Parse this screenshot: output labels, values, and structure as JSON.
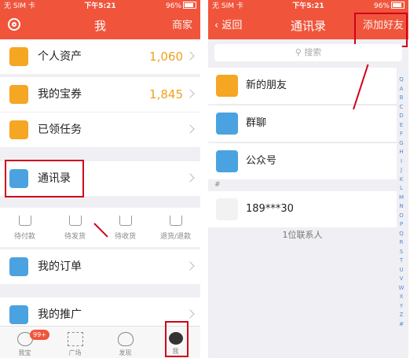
{
  "status": {
    "carrier": "无 SIM 卡",
    "time": "下午5:21",
    "battery": "96%"
  },
  "left": {
    "nav": {
      "title": "我",
      "right": "商家"
    },
    "items": [
      {
        "label": "个人资产",
        "value": "1,060",
        "icon": "wallet-icon",
        "color": "#f5a623"
      },
      {
        "label": "我的宝券",
        "value": "1,845",
        "icon": "coupon-icon",
        "color": "#f5a623"
      },
      {
        "label": "已领任务",
        "value": "",
        "icon": "task-icon",
        "color": "#f5a623"
      },
      {
        "label": "通讯录",
        "value": "",
        "icon": "contacts-icon",
        "color": "#4aa3e0"
      },
      {
        "label": "我的订单",
        "value": "",
        "icon": "cart-icon",
        "color": "#4aa3e0"
      },
      {
        "label": "我的推广",
        "value": "",
        "icon": "megaphone-icon",
        "color": "#4aa3e0"
      }
    ],
    "orders": [
      "待付款",
      "待发货",
      "待收货",
      "退货/退款"
    ],
    "tabs": [
      {
        "label": "我宝",
        "icon": "chat-icon",
        "badge": "99+"
      },
      {
        "label": "广场",
        "icon": "grid-icon",
        "badge": ""
      },
      {
        "label": "发现",
        "icon": "palette-icon",
        "badge": ""
      },
      {
        "label": "我",
        "icon": "profile-icon",
        "badge": ""
      }
    ]
  },
  "right": {
    "nav": {
      "back": "返回",
      "title": "通讯录",
      "right": "添加好友"
    },
    "search_placeholder": "搜索",
    "items": [
      {
        "label": "新的朋友",
        "icon": "new-friend-icon",
        "color": "#f5a623"
      },
      {
        "label": "群聊",
        "icon": "group-icon",
        "color": "#4aa3e0"
      },
      {
        "label": "公众号",
        "icon": "official-account-icon",
        "color": "#4aa3e0"
      }
    ],
    "section": "#",
    "contact": "189***30",
    "footer": "1位联系人",
    "index": [
      "Q",
      "A",
      "B",
      "C",
      "D",
      "E",
      "F",
      "G",
      "H",
      "I",
      "J",
      "K",
      "L",
      "M",
      "N",
      "O",
      "P",
      "Q",
      "R",
      "S",
      "T",
      "U",
      "V",
      "W",
      "X",
      "Y",
      "Z",
      "#"
    ]
  },
  "colors": {
    "brand": "#f0553c",
    "highlight": "#d0021b"
  }
}
